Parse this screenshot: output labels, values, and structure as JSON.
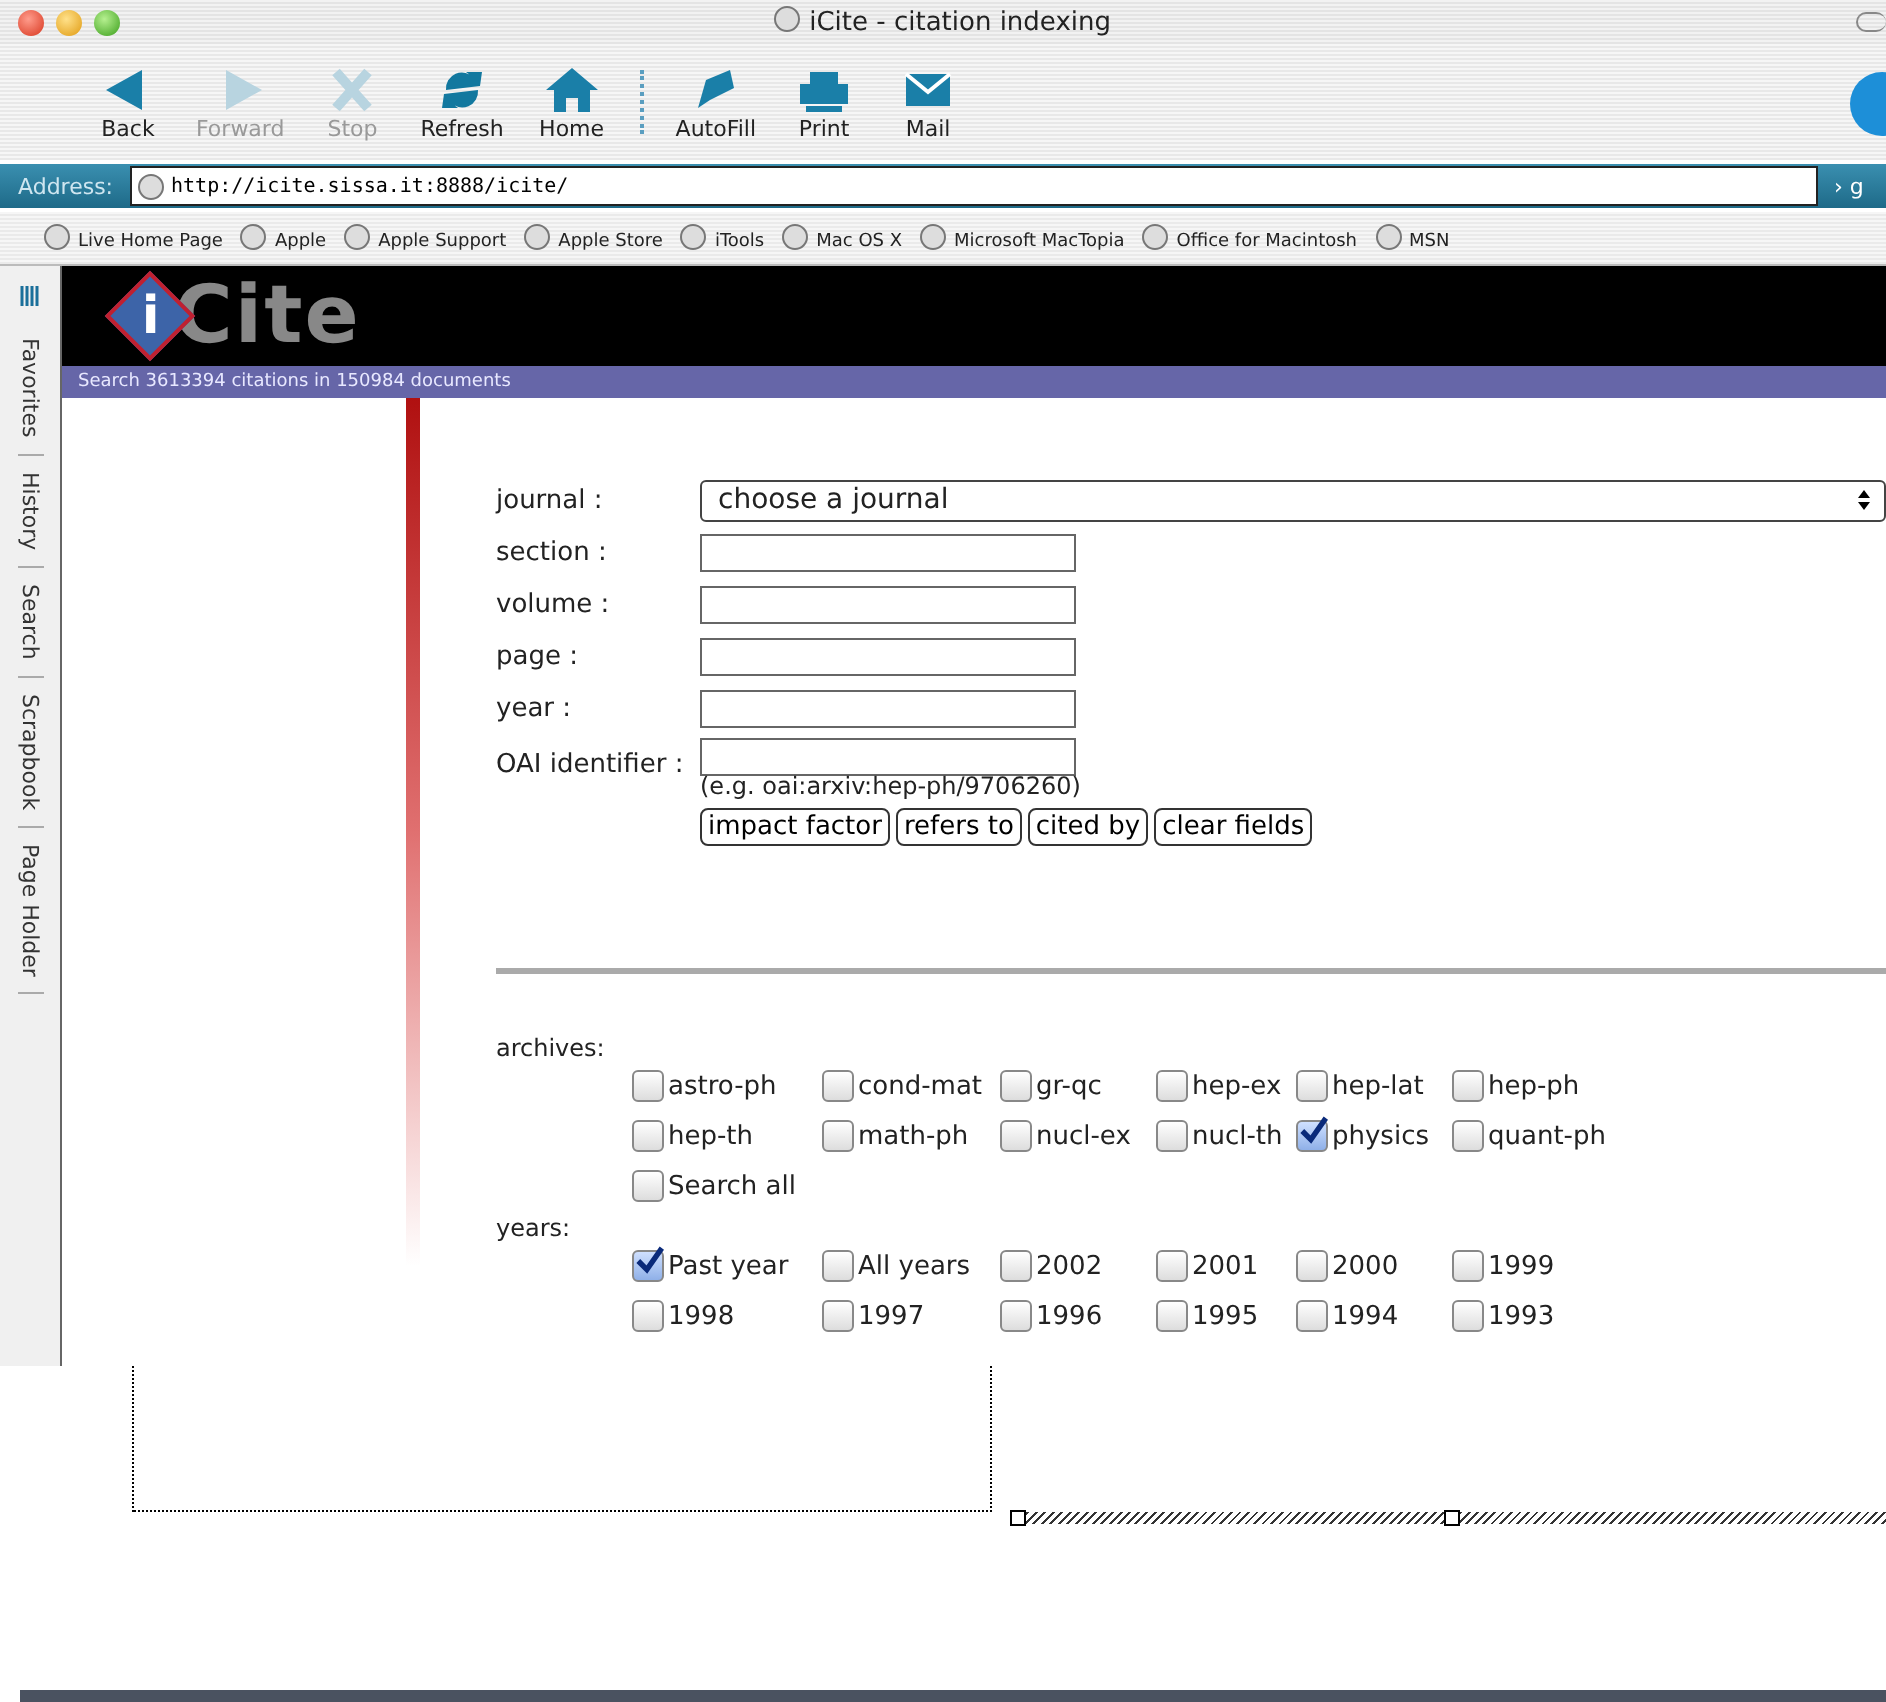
{
  "window": {
    "title": "iCite - citation indexing"
  },
  "toolbar": [
    {
      "kind": "back",
      "label": "Back",
      "disabled": false
    },
    {
      "kind": "forward",
      "label": "Forward",
      "disabled": true
    },
    {
      "kind": "stop",
      "label": "Stop",
      "disabled": true
    },
    {
      "kind": "refresh",
      "label": "Refresh",
      "disabled": false
    },
    {
      "kind": "home",
      "label": "Home",
      "disabled": false
    },
    {
      "kind": "separator"
    },
    {
      "kind": "autofill",
      "label": "AutoFill",
      "disabled": false
    },
    {
      "kind": "print",
      "label": "Print",
      "disabled": false
    },
    {
      "kind": "mail",
      "label": "Mail",
      "disabled": false
    }
  ],
  "address": {
    "label": "Address:",
    "url": "http://icite.sissa.it:8888/icite/",
    "go": "› g"
  },
  "favorites": [
    "Live Home Page",
    "Apple",
    "Apple Support",
    "Apple Store",
    "iTools",
    "Mac OS X",
    "Microsoft MacTopia",
    "Office for Macintosh",
    "MSN"
  ],
  "sidebar_tabs": [
    "Favorites",
    "History",
    "Search",
    "Scrapbook",
    "Page Holder"
  ],
  "page": {
    "logo": {
      "mark": "i",
      "text": "Cite"
    },
    "banner": "Search 3613394 citations in 150984 documents",
    "journal": {
      "label": "journal :",
      "value": "choose a journal"
    },
    "fields": [
      {
        "label": "section :"
      },
      {
        "label": "volume :"
      },
      {
        "label": "page :"
      },
      {
        "label": "year :"
      }
    ],
    "oai": {
      "label": "OAI identifier :",
      "hint": "(e.g. oai:arxiv:hep-ph/9706260)"
    },
    "buttons": [
      "impact factor",
      "refers to",
      "cited by",
      "clear fields"
    ],
    "archives": {
      "label": "archives:",
      "options": [
        {
          "label": "astro-ph",
          "checked": false
        },
        {
          "label": "cond-mat",
          "checked": false
        },
        {
          "label": "gr-qc",
          "checked": false
        },
        {
          "label": "hep-ex",
          "checked": false
        },
        {
          "label": "hep-lat",
          "checked": false
        },
        {
          "label": "hep-ph",
          "checked": false
        },
        {
          "label": "hep-th",
          "checked": false
        },
        {
          "label": "math-ph",
          "checked": false
        },
        {
          "label": "nucl-ex",
          "checked": false
        },
        {
          "label": "nucl-th",
          "checked": false
        },
        {
          "label": "physics",
          "checked": true
        },
        {
          "label": "quant-ph",
          "checked": false
        },
        {
          "label": "Search all",
          "checked": false
        }
      ]
    },
    "years": {
      "label": "years:",
      "options": [
        {
          "label": "Past year",
          "checked": true
        },
        {
          "label": "All years",
          "checked": false
        },
        {
          "label": "2002",
          "checked": false
        },
        {
          "label": "2001",
          "checked": false
        },
        {
          "label": "2000",
          "checked": false
        },
        {
          "label": "1999",
          "checked": false
        },
        {
          "label": "1998",
          "checked": false
        },
        {
          "label": "1997",
          "checked": false
        },
        {
          "label": "1996",
          "checked": false
        },
        {
          "label": "1995",
          "checked": false
        },
        {
          "label": "1994",
          "checked": false
        },
        {
          "label": "1993",
          "checked": false
        }
      ]
    }
  }
}
